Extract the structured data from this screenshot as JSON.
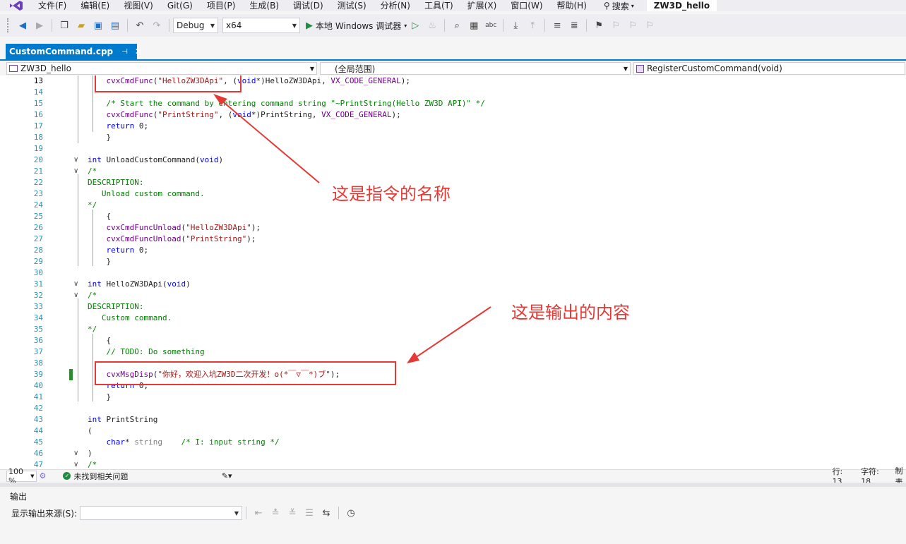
{
  "menu": {
    "items": [
      "文件(F)",
      "编辑(E)",
      "视图(V)",
      "Git(G)",
      "项目(P)",
      "生成(B)",
      "调试(D)",
      "测试(S)",
      "分析(N)",
      "工具(T)",
      "扩展(X)",
      "窗口(W)",
      "帮助(H)"
    ],
    "search": "搜索",
    "solution": "ZW3D_hello"
  },
  "toolbar": {
    "config": "Debug",
    "platform": "x64",
    "run_label": "本地 Windows 调试器"
  },
  "tab": {
    "filename": "CustomCommand.cpp"
  },
  "navbar": {
    "project": "ZW3D_hello",
    "scope": "(全局范围)",
    "function": "RegisterCustomCommand(void)"
  },
  "code": {
    "lines": [
      {
        "n": "13",
        "html": "    <span class='mac'>cvxCmdFunc</span>(<span class='str'>\"HelloZW3DApi\"</span>, (<span class='kw'>void</span>*)HelloZW3DApi, <span class='mac'>VX_CODE_GENERAL</span>);"
      },
      {
        "n": "14",
        "html": ""
      },
      {
        "n": "15",
        "html": "    <span class='cmt'>/* Start the command by entering command string \"~PrintString(Hello ZW3D API)\" */</span>"
      },
      {
        "n": "16",
        "html": "    <span class='mac'>cvxCmdFunc</span>(<span class='str'>\"PrintString\"</span>, (<span class='kw'>void</span>*)PrintString, <span class='mac'>VX_CODE_GENERAL</span>);"
      },
      {
        "n": "17",
        "html": "    <span class='kw'>return</span> 0;"
      },
      {
        "n": "18",
        "html": "    }"
      },
      {
        "n": "19",
        "html": ""
      },
      {
        "n": "20",
        "html": "<span class='kw'>int</span> UnloadCustomCommand(<span class='kw'>void</span>)"
      },
      {
        "n": "21",
        "html": "<span class='cmt'>/*</span>"
      },
      {
        "n": "22",
        "html": "<span class='cmt'>DESCRIPTION:</span>"
      },
      {
        "n": "23",
        "html": "<span class='cmt'>   Unload custom command.</span>"
      },
      {
        "n": "24",
        "html": "<span class='cmt'>*/</span>"
      },
      {
        "n": "25",
        "html": "    {"
      },
      {
        "n": "26",
        "html": "    <span class='mac'>cvxCmdFuncUnload</span>(<span class='str'>\"HelloZW3DApi\"</span>);"
      },
      {
        "n": "27",
        "html": "    <span class='mac'>cvxCmdFuncUnload</span>(<span class='str'>\"PrintString\"</span>);"
      },
      {
        "n": "28",
        "html": "    <span class='kw'>return</span> 0;"
      },
      {
        "n": "29",
        "html": "    }"
      },
      {
        "n": "30",
        "html": ""
      },
      {
        "n": "31",
        "html": "<span class='kw'>int</span> HelloZW3DApi(<span class='kw'>void</span>)"
      },
      {
        "n": "32",
        "html": "<span class='cmt'>/*</span>"
      },
      {
        "n": "33",
        "html": "<span class='cmt'>DESCRIPTION:</span>"
      },
      {
        "n": "34",
        "html": "<span class='cmt'>   Custom command.</span>"
      },
      {
        "n": "35",
        "html": "<span class='cmt'>*/</span>"
      },
      {
        "n": "36",
        "html": "    {"
      },
      {
        "n": "37",
        "html": "    <span class='cmt'>// TODO: Do something</span>"
      },
      {
        "n": "38",
        "html": ""
      },
      {
        "n": "39",
        "html": "    <span class='mac'>cvxMsgDisp</span>(<span class='str'>\"你好，欢迎入坑ZW3D二次开发！o(*￣▽￣*)ブ\"</span>);"
      },
      {
        "n": "40",
        "html": "    <span class='kw'>return</span> 0;"
      },
      {
        "n": "41",
        "html": "    }"
      },
      {
        "n": "42",
        "html": ""
      },
      {
        "n": "43",
        "html": "<span class='kw'>int</span> PrintString"
      },
      {
        "n": "44",
        "html": "("
      },
      {
        "n": "45",
        "html": "    <span class='kw'>char</span>* <span class='par'>string</span>    <span class='cmt'>/* I: input string */</span>"
      },
      {
        "n": "46",
        "html": ")"
      },
      {
        "n": "47",
        "html": "<span class='cmt'>/*</span>"
      }
    ]
  },
  "annotations": {
    "command_name": "这是指令的名称",
    "output_content": "这是输出的内容"
  },
  "status": {
    "zoom": "100 %",
    "issues": "未找到相关问题",
    "line": "行: 13",
    "col": "字符: 18",
    "tail": "制表"
  },
  "output": {
    "title": "输出",
    "source_label": "显示输出来源(S):",
    "source_value": ""
  },
  "colors": {
    "accent": "#007acc",
    "annotation": "#e53935",
    "keyword": "#0000ff",
    "string": "#a31515",
    "comment": "#008000",
    "macro": "#6f008a"
  }
}
